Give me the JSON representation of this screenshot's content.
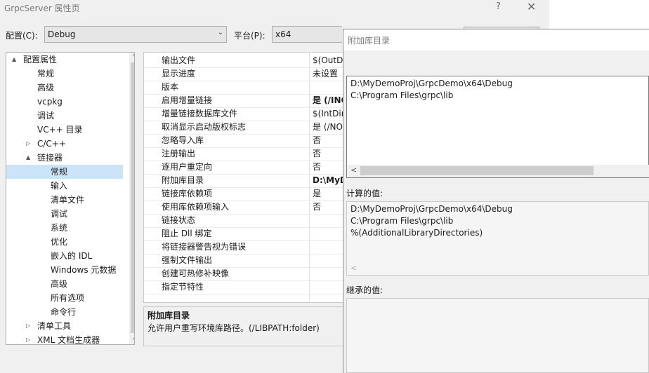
{
  "title": "GrpcServer 属性页",
  "title_buttons": {
    "help": "?",
    "close": "✕"
  },
  "config_label": "配置(C):",
  "config_value": "Debug",
  "platform_label": "平台(P):",
  "platform_value": "x64",
  "tree": [
    {
      "label": "配置属性",
      "indent": 0,
      "toggle": "▲"
    },
    {
      "label": "常规",
      "indent": 1
    },
    {
      "label": "高级",
      "indent": 1
    },
    {
      "label": "vcpkg",
      "indent": 1
    },
    {
      "label": "调试",
      "indent": 1
    },
    {
      "label": "VC++ 目录",
      "indent": 1
    },
    {
      "label": "C/C++",
      "indent": 1,
      "toggle": "▷"
    },
    {
      "label": "链接器",
      "indent": 1,
      "toggle": "▲"
    },
    {
      "label": "常规",
      "indent": 2,
      "selected": true
    },
    {
      "label": "输入",
      "indent": 2
    },
    {
      "label": "清单文件",
      "indent": 2
    },
    {
      "label": "调试",
      "indent": 2
    },
    {
      "label": "系统",
      "indent": 2
    },
    {
      "label": "优化",
      "indent": 2
    },
    {
      "label": "嵌入的 IDL",
      "indent": 2
    },
    {
      "label": "Windows 元数据",
      "indent": 2
    },
    {
      "label": "高级",
      "indent": 2
    },
    {
      "label": "所有选项",
      "indent": 2
    },
    {
      "label": "命令行",
      "indent": 2
    },
    {
      "label": "清单工具",
      "indent": 1,
      "toggle": "▷"
    },
    {
      "label": "XML 文档生成器",
      "indent": 1,
      "toggle": "▷"
    }
  ],
  "grid_rows": [
    {
      "name": "输出文件",
      "value": "$(OutDi",
      "bold": false
    },
    {
      "name": "显示进度",
      "value": "未设置",
      "bold": false
    },
    {
      "name": "版本",
      "value": "",
      "bold": false
    },
    {
      "name": "启用增量链接",
      "value": "是 (/INC",
      "bold": true
    },
    {
      "name": "增量链接数据库文件",
      "value": "$(IntDir",
      "bold": false
    },
    {
      "name": "取消显示启动版权标志",
      "value": "是 (/NO",
      "bold": false
    },
    {
      "name": "忽略导入库",
      "value": "否",
      "bold": false
    },
    {
      "name": "注册输出",
      "value": "否",
      "bold": false
    },
    {
      "name": "逐用户重定向",
      "value": "否",
      "bold": false
    },
    {
      "name": "附加库目录",
      "value": "D:\\MyD",
      "bold": true
    },
    {
      "name": "链接库依赖项",
      "value": "是",
      "bold": false
    },
    {
      "name": "使用库依赖项输入",
      "value": "否",
      "bold": false
    },
    {
      "name": "链接状态",
      "value": "",
      "bold": false
    },
    {
      "name": "阻止 Dll 绑定",
      "value": "",
      "bold": false
    },
    {
      "name": "将链接器警告视为错误",
      "value": "",
      "bold": false
    },
    {
      "name": "强制文件输出",
      "value": "",
      "bold": false
    },
    {
      "name": "创建可热修补映像",
      "value": "",
      "bold": false
    },
    {
      "name": "指定节特性",
      "value": "",
      "bold": false
    }
  ],
  "description": {
    "title": "附加库目录",
    "text": "允许用户重写环境库路径。(/LIBPATH:folder)"
  },
  "child": {
    "title": "附加库目录",
    "lines": [
      "D:\\MyDemoProj\\GrpcDemo\\x64\\Debug",
      "C:\\Program Files\\grpc\\lib"
    ],
    "computed_label": "计算的值:",
    "computed_lines": [
      "D:\\MyDemoProj\\GrpcDemo\\x64\\Debug",
      "C:\\Program Files\\grpc\\lib",
      "%(AdditionalLibraryDirectories)"
    ],
    "inherited_label": "继承的值:"
  }
}
